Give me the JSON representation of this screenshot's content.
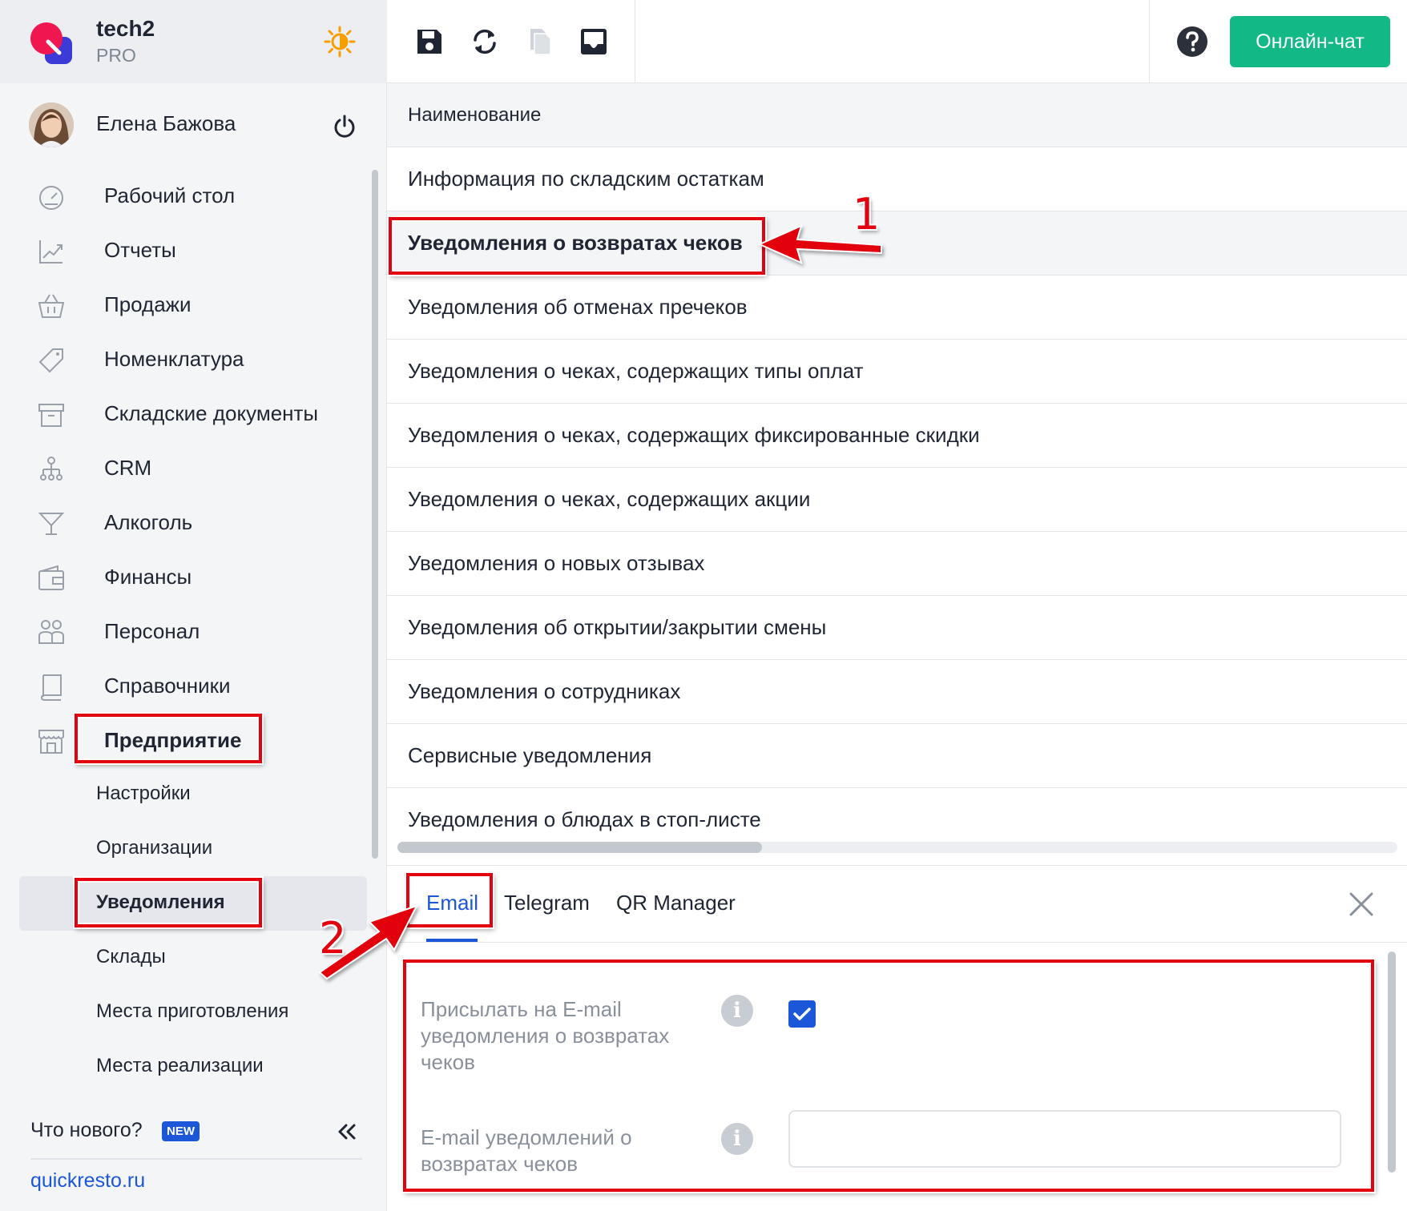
{
  "brand": {
    "name": "tech2",
    "plan": "PRO"
  },
  "user": {
    "name": "Елена Бажова"
  },
  "nav": {
    "items": [
      {
        "label": "Рабочий стол",
        "icon": "dashboard-icon"
      },
      {
        "label": "Отчеты",
        "icon": "chart-icon"
      },
      {
        "label": "Продажи",
        "icon": "basket-icon"
      },
      {
        "label": "Номенклатура",
        "icon": "tag-icon"
      },
      {
        "label": "Складские документы",
        "icon": "archive-icon"
      },
      {
        "label": "CRM",
        "icon": "hierarchy-icon"
      },
      {
        "label": "Алкоголь",
        "icon": "cocktail-icon"
      },
      {
        "label": "Финансы",
        "icon": "wallet-icon"
      },
      {
        "label": "Персонал",
        "icon": "people-icon"
      },
      {
        "label": "Справочники",
        "icon": "book-icon"
      },
      {
        "label": "Предприятие",
        "icon": "store-icon"
      }
    ],
    "subitems": [
      {
        "label": "Настройки"
      },
      {
        "label": "Организации"
      },
      {
        "label": "Уведомления"
      },
      {
        "label": "Склады"
      },
      {
        "label": "Места приготовления"
      },
      {
        "label": "Места реализации"
      }
    ],
    "active_subitem": "Уведомления"
  },
  "footer": {
    "whats_new": "Что нового?",
    "new_badge": "NEW",
    "site": "quickresto.ru"
  },
  "topbar": {
    "chat_label": "Онлайн-чат"
  },
  "table": {
    "header": "Наименование",
    "rows": [
      "Информация по складским остаткам",
      "Уведомления о возвратах чеков",
      "Уведомления об отменах пречеков",
      "Уведомления о чеках, содержащих типы оплат",
      "Уведомления о чеках, содержащих фиксированные скидки",
      "Уведомления о чеках, содержащих акции",
      "Уведомления о новых отзывах",
      "Уведомления об открытии/закрытии смены",
      "Уведомления о сотрудниках",
      "Сервисные уведомления",
      "Уведомления о блюдах в стоп-листе"
    ],
    "selected_row": "Уведомления о возвратах чеков"
  },
  "panel": {
    "tabs": [
      "Email",
      "Telegram",
      "QR Manager"
    ],
    "active_tab": "Email",
    "send_email_label": "Присылать на E-mail уведомления о возвратах чеков",
    "send_email_checked": true,
    "email_label": "E-mail уведомлений о возвратах чеков",
    "email_value": ""
  },
  "annotations": {
    "callout_1": "1",
    "callout_2": "2"
  },
  "colors": {
    "accent": "#1b57d8",
    "chat_button": "#12b886",
    "annotation": "#e3000f"
  }
}
